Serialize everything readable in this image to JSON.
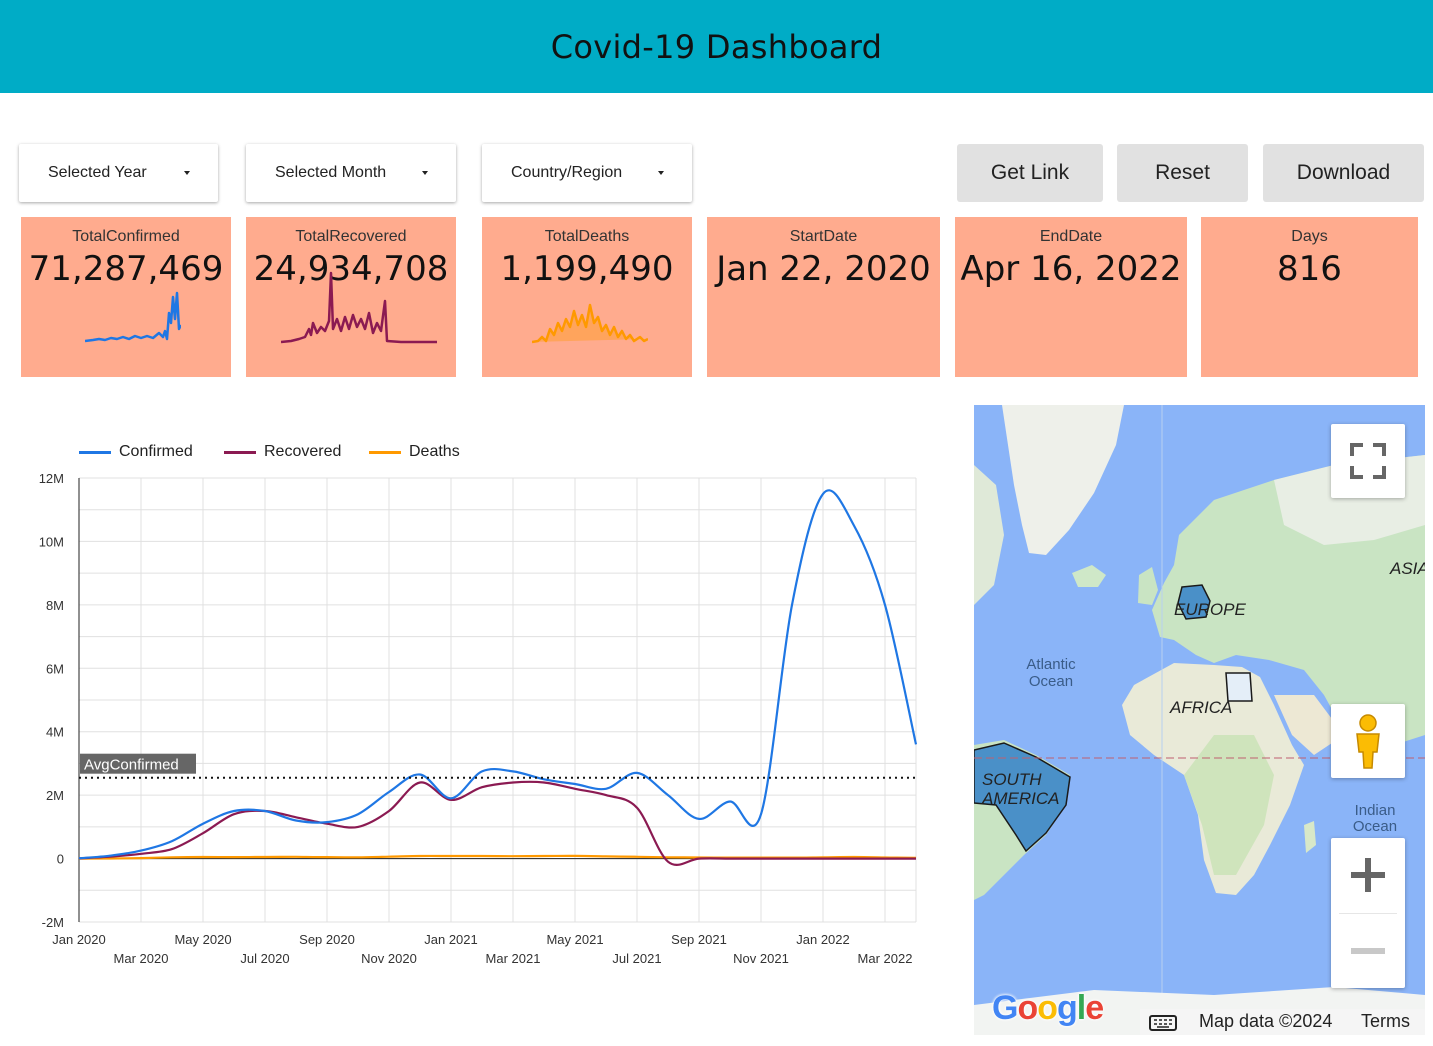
{
  "header": {
    "title": "Covid-19 Dashboard",
    "bg": "#00acc6"
  },
  "filters": [
    {
      "label": "Selected Year"
    },
    {
      "label": "Selected Month"
    },
    {
      "label": "Country/Region"
    }
  ],
  "buttons": {
    "get_link": "Get Link",
    "reset": "Reset",
    "download": "Download"
  },
  "kpis": [
    {
      "label": "TotalConfirmed",
      "value": "71,287,469",
      "spark_color": "#1f77e4"
    },
    {
      "label": "TotalRecovered",
      "value": "24,934,708",
      "spark_color": "#8b1a52"
    },
    {
      "label": "TotalDeaths",
      "value": "1,199,490",
      "spark_color": "#ff9900"
    },
    {
      "label": "StartDate",
      "value": "Jan 22, 2020"
    },
    {
      "label": "EndDate",
      "value": "Apr 16, 2022"
    },
    {
      "label": "Days",
      "value": "816"
    }
  ],
  "chart_data": {
    "type": "line",
    "x": [
      "2020-01",
      "2020-02",
      "2020-03",
      "2020-04",
      "2020-05",
      "2020-06",
      "2020-07",
      "2020-08",
      "2020-09",
      "2020-10",
      "2020-11",
      "2020-12",
      "2021-01",
      "2021-02",
      "2021-03",
      "2021-04",
      "2021-05",
      "2021-06",
      "2021-07",
      "2021-08",
      "2021-09",
      "2021-10",
      "2021-11",
      "2021-12",
      "2022-01",
      "2022-02",
      "2022-03",
      "2022-04"
    ],
    "x_tick_labels": [
      "Jan 2020",
      "Mar 2020",
      "May 2020",
      "Jul 2020",
      "Sep 2020",
      "Nov 2020",
      "Jan 2021",
      "Mar 2021",
      "May 2021",
      "Jul 2021",
      "Sep 2021",
      "Nov 2021",
      "Jan 2022",
      "Mar 2022"
    ],
    "y_tick_labels": [
      "12M",
      "10M",
      "8M",
      "6M",
      "4M",
      "2M",
      "0",
      "-2M"
    ],
    "ylim": [
      -2000000,
      12000000
    ],
    "series": [
      {
        "name": "Confirmed",
        "color": "#1f77e4",
        "values": [
          10000,
          90000,
          250000,
          550000,
          1100000,
          1500000,
          1500000,
          1200000,
          1150000,
          1400000,
          2100000,
          2650000,
          1900000,
          2750000,
          2750000,
          2500000,
          2350000,
          2200000,
          2700000,
          2000000,
          1250000,
          1800000,
          1400000,
          8000000,
          11500000,
          10500000,
          8000000,
          3600000
        ]
      },
      {
        "name": "Recovered",
        "color": "#8b1a52",
        "values": [
          5000,
          60000,
          150000,
          300000,
          800000,
          1400000,
          1500000,
          1300000,
          1100000,
          1000000,
          1500000,
          2400000,
          1850000,
          2250000,
          2400000,
          2400000,
          2200000,
          2000000,
          1600000,
          -100000,
          0,
          0,
          0,
          0,
          0,
          0,
          0,
          0
        ]
      },
      {
        "name": "Deaths",
        "color": "#ff9900",
        "values": [
          0,
          3000,
          15000,
          40000,
          50000,
          45000,
          50000,
          55000,
          45000,
          40000,
          60000,
          80000,
          80000,
          80000,
          75000,
          80000,
          85000,
          70000,
          55000,
          40000,
          35000,
          30000,
          30000,
          30000,
          40000,
          50000,
          35000,
          20000
        ]
      }
    ],
    "reference_line": {
      "label": "AvgConfirmed",
      "value": 2550000
    },
    "legend": "top-left",
    "grid": true
  },
  "map": {
    "labels": {
      "atlantic": "Atlantic Ocean",
      "europe": "EUROPE",
      "africa": "AFRICA",
      "south_america": "SOUTH AMERICA",
      "asia": "ASIA",
      "indian": "Indian Ocean"
    },
    "attribution": "Map data ©2024",
    "terms": "Terms",
    "logo": "Google"
  }
}
